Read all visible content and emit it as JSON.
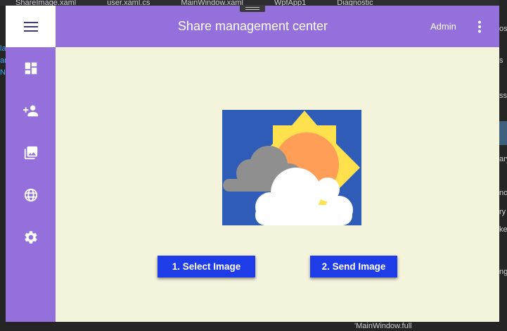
{
  "ide": {
    "tabs": [
      "ShareImage.xaml",
      "user.xaml.cs",
      "MainWindow.xaml",
      "WpfApp1",
      "Diagnostic"
    ],
    "left_marks": [
      "la",
      "am",
      "N"
    ],
    "right_marks": [
      "ost",
      "s",
      "ss",
      "ary",
      "now",
      "ry",
      "ke",
      "ngs"
    ],
    "bottom_text": "'MainWindow.full"
  },
  "header": {
    "title": "Share management center",
    "user": "Admin"
  },
  "sidebar": {
    "items": [
      {
        "icon": "dashboard-icon"
      },
      {
        "icon": "add-user-icon"
      },
      {
        "icon": "images-icon"
      },
      {
        "icon": "globe-icon"
      },
      {
        "icon": "settings-icon"
      }
    ]
  },
  "main": {
    "image_icon": "partly-cloudy-weather-icon",
    "select_button": "1. Select Image",
    "send_button": "2. Send Image"
  },
  "colors": {
    "accent": "#9370db",
    "content_bg": "#f4f3dc",
    "button": "#1e3de8",
    "image_bg": "#2f5cb6",
    "sun": "#ffe04d",
    "sun_core": "#ff9f57",
    "cloud_back": "#8f8f8f",
    "cloud_front": "#ffffff"
  }
}
